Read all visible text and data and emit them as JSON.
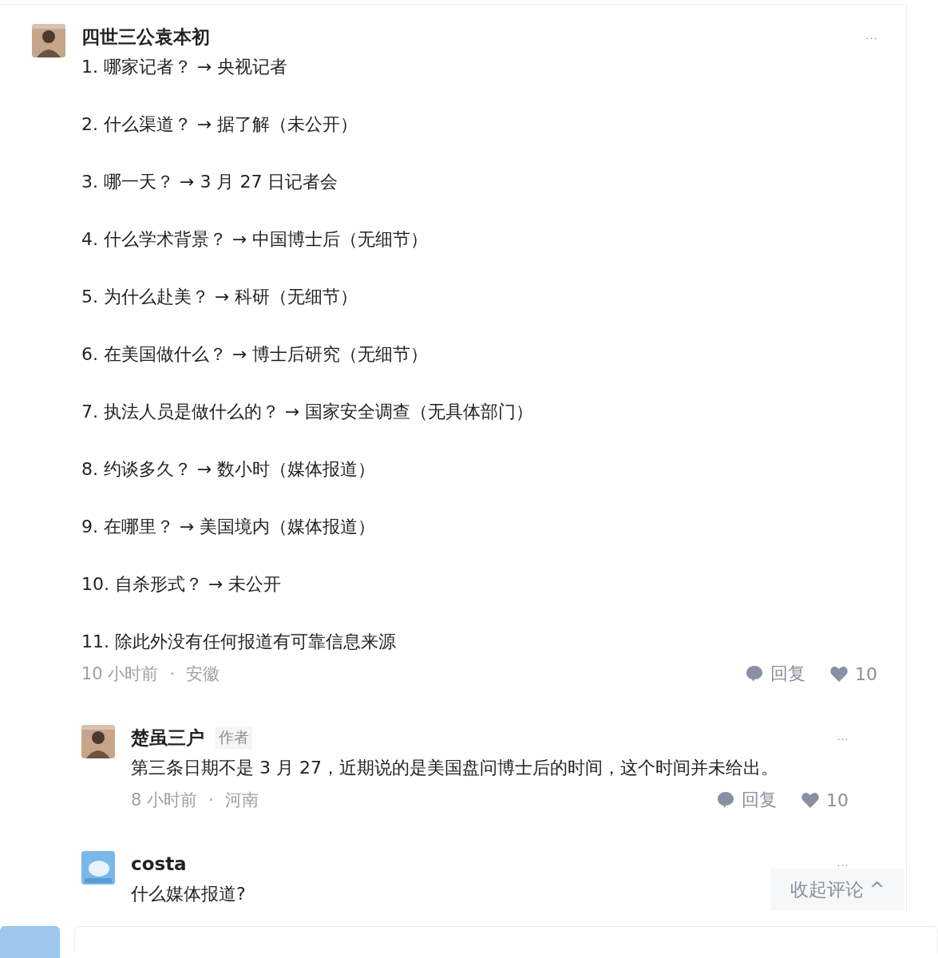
{
  "comments": [
    {
      "author": "四世三公袁本初",
      "lines": [
        "1. 哪家记者？ → 央视记者",
        "2. 什么渠道？ → 据了解（未公开）",
        "3. 哪一天？ → 3 月 27 日记者会",
        "4. 什么学术背景？ → 中国博士后（无细节）",
        "5. 为什么赴美？ → 科研（无细节）",
        "6. 在美国做什么？ → 博士后研究（无细节）",
        "7. 执法人员是做什么的？ → 国家安全调查（无具体部门）",
        "8. 约谈多久？ → 数小时（媒体报道）",
        "9. 在哪里？ → 美国境内（媒体报道）",
        "10. 自杀形式？ → 未公开",
        "11. 除此外没有任何报道有可靠信息来源"
      ],
      "time": "10 小时前",
      "separator": "·",
      "location": "安徽",
      "reply_label": "回复",
      "likes": "10",
      "more": "···",
      "replies": [
        {
          "author": "楚虽三户",
          "author_badge": "作者",
          "lines": [
            "第三条日期不是 3 月 27，近期说的是美国盘问博士后的时间，这个时间并未给出。"
          ],
          "time": "8 小时前",
          "separator": "·",
          "location": "河南",
          "reply_label": "回复",
          "likes": "10",
          "more": "···"
        },
        {
          "author": "costa",
          "lines": [
            "什么媒体报道?"
          ],
          "more": "···"
        }
      ]
    }
  ],
  "collapse_button": "收起评论 ^"
}
